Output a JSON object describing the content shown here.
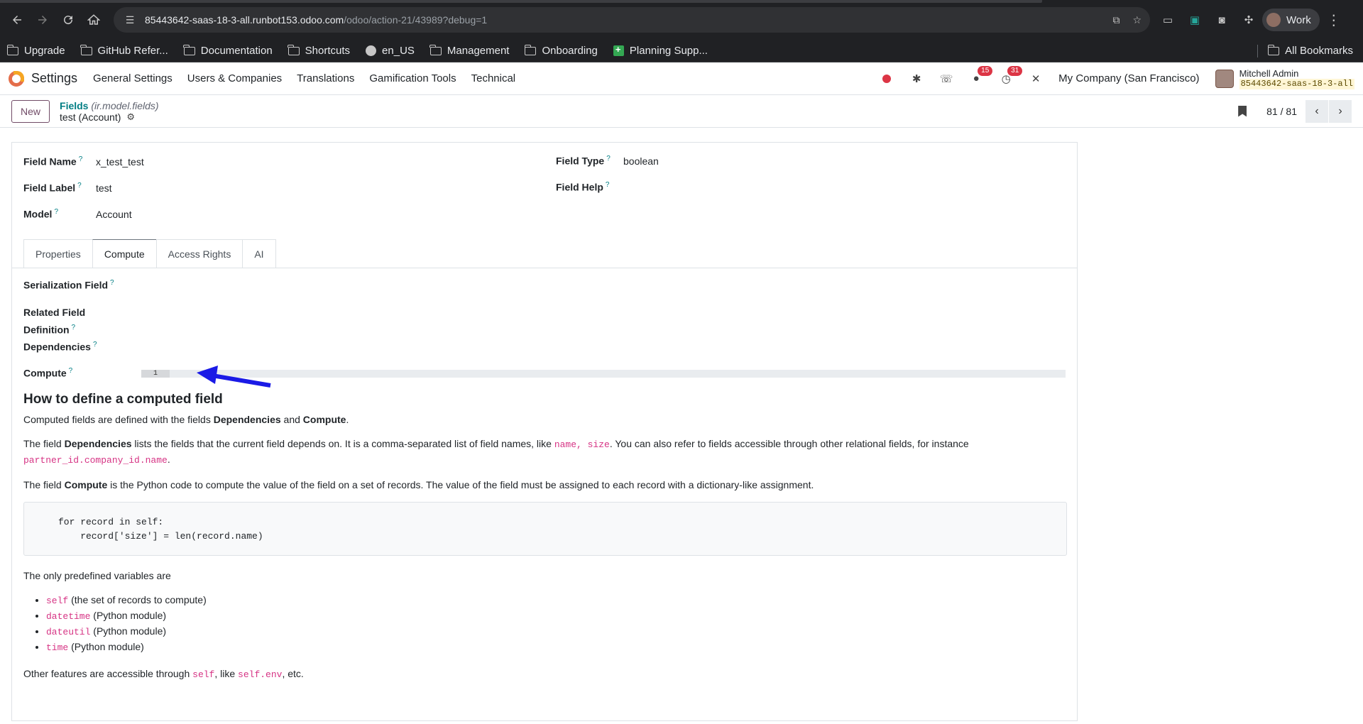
{
  "browser": {
    "url_host": "85443642-saas-18-3-all.runbot153.odoo.com",
    "url_path": "/odoo/action-21/43989?debug=1",
    "profile_label": "Work"
  },
  "bookmarks": [
    {
      "label": "Upgrade",
      "icon": "folder-icon"
    },
    {
      "label": "GitHub Refer...",
      "icon": "folder-icon"
    },
    {
      "label": "Documentation",
      "icon": "folder-icon"
    },
    {
      "label": "Shortcuts",
      "icon": "folder-icon"
    },
    {
      "label": "en_US",
      "icon": "globe-icon"
    },
    {
      "label": "Management",
      "icon": "folder-icon"
    },
    {
      "label": "Onboarding",
      "icon": "folder-icon"
    },
    {
      "label": "Planning Supp...",
      "icon": "sheets-icon"
    }
  ],
  "bookmarks_all": "All Bookmarks",
  "navbar": {
    "app_name": "Settings",
    "menus": [
      "General Settings",
      "Users & Companies",
      "Translations",
      "Gamification Tools",
      "Technical"
    ],
    "messages_count": "15",
    "activities_count": "31",
    "company": "My Company (San Francisco)",
    "user_name": "Mitchell Admin",
    "db_name": "85443642-saas-18-3-all"
  },
  "control": {
    "new_label": "New",
    "breadcrumb_parent": "Fields",
    "breadcrumb_model": "(ir.model.fields)",
    "breadcrumb_current": "test (Account)",
    "pager_value": "81 / 81"
  },
  "form": {
    "field_name_label": "Field Name",
    "field_name_value": "x_test_test",
    "field_label_label": "Field Label",
    "field_label_value": "test",
    "model_label": "Model",
    "model_value": "Account",
    "field_type_label": "Field Type",
    "field_type_value": "boolean",
    "field_help_label": "Field Help",
    "tabs": [
      "Properties",
      "Compute",
      "Access Rights",
      "AI"
    ],
    "active_tab": "Compute",
    "serialization_label": "Serialization Field",
    "related_label_1": "Related Field",
    "related_label_2": "Definition",
    "dependencies_label": "Dependencies",
    "compute_label": "Compute",
    "editor_line_number": "1"
  },
  "help": {
    "title": "How to define a computed field",
    "p1_a": "Computed fields are defined with the fields ",
    "p1_b": "Dependencies",
    "p1_c": " and ",
    "p1_d": "Compute",
    "p1_e": ".",
    "p2_a": "The field ",
    "p2_b": "Dependencies",
    "p2_c": " lists the fields that the current field depends on. It is a comma-separated list of field names, like ",
    "p2_code1": "name, size",
    "p2_d": ". You can also refer to fields accessible through other relational fields, for instance ",
    "p2_code2": "partner_id.company_id.name",
    "p2_e": ".",
    "p3_a": "The field ",
    "p3_b": "Compute",
    "p3_c": " is the Python code to compute the value of the field on a set of records. The value of the field must be assigned to each record with a dictionary-like assignment.",
    "code_line1": "for record in self:",
    "code_line2": "    record['size'] = len(record.name)",
    "vars_intro": "The only predefined variables are",
    "vars": [
      {
        "code": "self",
        "desc": " (the set of records to compute)"
      },
      {
        "code": "datetime",
        "desc": " (Python module)"
      },
      {
        "code": "dateutil",
        "desc": " (Python module)"
      },
      {
        "code": "time",
        "desc": " (Python module)"
      }
    ],
    "other_a": "Other features are accessible through ",
    "other_code1": "self",
    "other_b": ", like ",
    "other_code2": "self.env",
    "other_c": ", etc."
  }
}
